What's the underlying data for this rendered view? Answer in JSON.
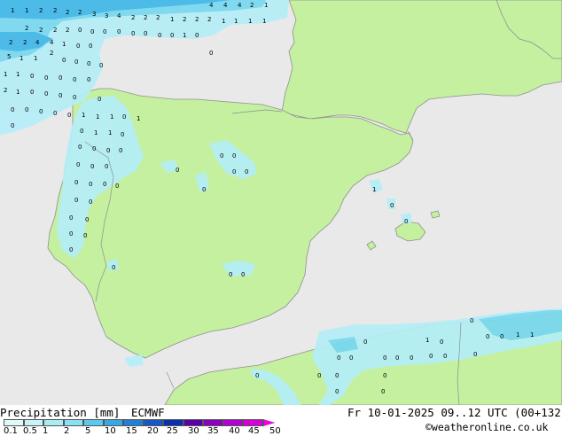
{
  "title": "Precipitation [mm]",
  "model": "ECMWF",
  "valid_time": "Fr 10-01-2025 09..12 UTC (00+132)",
  "credit": "©weatheronline.co.uk",
  "colors": {
    "sea": "#e9e9e9",
    "land": "#c4f0a0",
    "precip_light": "#b4eef8",
    "precip_medium": "#78d8f0",
    "precip_heavy": "#40b8e8",
    "border": "#909090"
  },
  "legend": {
    "labels": [
      "0.1",
      "0.5",
      "1",
      "2",
      "5",
      "10",
      "15",
      "20",
      "25",
      "30",
      "35",
      "40",
      "45",
      "50"
    ],
    "colors": [
      "#e0f8f8",
      "#c8f4f8",
      "#a8ecf6",
      "#88e0f2",
      "#5cc8ee",
      "#38a8e4",
      "#2080d8",
      "#1458c8",
      "#0a30b0",
      "#5a00a8",
      "#8c00c0",
      "#b400d0",
      "#d800d8",
      "#f000e0"
    ]
  },
  "map_values": [
    {
      "v": "1",
      "g": [
        12,
        8
      ]
    },
    {
      "v": "1",
      "g": [
        28,
        8
      ]
    },
    {
      "v": "2",
      "g": [
        44,
        8
      ]
    },
    {
      "v": "2",
      "g": [
        60,
        8
      ]
    },
    {
      "v": "2",
      "g": [
        74,
        10
      ]
    },
    {
      "v": "2",
      "g": [
        88,
        10
      ]
    },
    {
      "v": "3",
      "g": [
        104,
        12
      ]
    },
    {
      "v": "3",
      "g": [
        118,
        14
      ]
    },
    {
      "v": "4",
      "g": [
        132,
        14
      ]
    },
    {
      "v": "2",
      "g": [
        148,
        16
      ]
    },
    {
      "v": "2",
      "g": [
        162,
        16
      ]
    },
    {
      "v": "2",
      "g": [
        176,
        16
      ]
    },
    {
      "v": "1",
      "g": [
        192,
        18
      ]
    },
    {
      "v": "2",
      "g": [
        206,
        18
      ]
    },
    {
      "v": "2",
      "g": [
        220,
        18
      ]
    },
    {
      "v": "2",
      "g": [
        234,
        18
      ]
    },
    {
      "v": "1",
      "g": [
        250,
        20
      ]
    },
    {
      "v": "1",
      "g": [
        264,
        20
      ]
    },
    {
      "v": "1",
      "g": [
        280,
        20
      ]
    },
    {
      "v": "1",
      "g": [
        296,
        20
      ]
    },
    {
      "v": "4",
      "g": [
        236,
        2
      ]
    },
    {
      "v": "4",
      "g": [
        252,
        2
      ]
    },
    {
      "v": "4",
      "g": [
        268,
        2
      ]
    },
    {
      "v": "2",
      "g": [
        282,
        2
      ]
    },
    {
      "v": "1",
      "g": [
        298,
        2
      ]
    },
    {
      "v": "2",
      "g": [
        28,
        28
      ]
    },
    {
      "v": "2",
      "g": [
        44,
        30
      ]
    },
    {
      "v": "2",
      "g": [
        60,
        30
      ]
    },
    {
      "v": "2",
      "g": [
        74,
        30
      ]
    },
    {
      "v": "0",
      "g": [
        88,
        30
      ]
    },
    {
      "v": "0",
      "g": [
        102,
        32
      ]
    },
    {
      "v": "0",
      "g": [
        116,
        32
      ]
    },
    {
      "v": "0",
      "g": [
        132,
        32
      ]
    },
    {
      "v": "0",
      "g": [
        148,
        34
      ]
    },
    {
      "v": "0",
      "g": [
        162,
        34
      ]
    },
    {
      "v": "0",
      "g": [
        178,
        36
      ]
    },
    {
      "v": "0",
      "g": [
        192,
        36
      ]
    },
    {
      "v": "1",
      "g": [
        206,
        36
      ]
    },
    {
      "v": "0",
      "g": [
        220,
        36
      ]
    },
    {
      "v": "0",
      "g": [
        236,
        56
      ]
    },
    {
      "v": "2",
      "g": [
        10,
        44
      ]
    },
    {
      "v": "2",
      "g": [
        26,
        44
      ]
    },
    {
      "v": "4",
      "g": [
        40,
        44
      ]
    },
    {
      "v": "4",
      "g": [
        56,
        44
      ]
    },
    {
      "v": "1",
      "g": [
        70,
        46
      ]
    },
    {
      "v": "0",
      "g": [
        86,
        48
      ]
    },
    {
      "v": "0",
      "g": [
        100,
        48
      ]
    },
    {
      "v": "2",
      "g": [
        56,
        56
      ]
    },
    {
      "v": "5",
      "g": [
        8,
        60
      ]
    },
    {
      "v": "1",
      "g": [
        22,
        62
      ]
    },
    {
      "v": "1",
      "g": [
        38,
        62
      ]
    },
    {
      "v": "0",
      "g": [
        70,
        64
      ]
    },
    {
      "v": "0",
      "g": [
        84,
        66
      ]
    },
    {
      "v": "0",
      "g": [
        98,
        68
      ]
    },
    {
      "v": "0",
      "g": [
        112,
        70
      ]
    },
    {
      "v": "1",
      "g": [
        4,
        80
      ]
    },
    {
      "v": "1",
      "g": [
        18,
        80
      ]
    },
    {
      "v": "0",
      "g": [
        34,
        82
      ]
    },
    {
      "v": "0",
      "g": [
        50,
        84
      ]
    },
    {
      "v": "0",
      "g": [
        66,
        84
      ]
    },
    {
      "v": "0",
      "g": [
        82,
        86
      ]
    },
    {
      "v": "0",
      "g": [
        98,
        86
      ]
    },
    {
      "v": "2",
      "g": [
        4,
        98
      ]
    },
    {
      "v": "1",
      "g": [
        18,
        100
      ]
    },
    {
      "v": "0",
      "g": [
        34,
        100
      ]
    },
    {
      "v": "0",
      "g": [
        50,
        102
      ]
    },
    {
      "v": "0",
      "g": [
        66,
        104
      ]
    },
    {
      "v": "0",
      "g": [
        82,
        106
      ]
    },
    {
      "v": "0",
      "g": [
        110,
        108
      ]
    },
    {
      "v": "0",
      "g": [
        12,
        120
      ]
    },
    {
      "v": "0",
      "g": [
        28,
        120
      ]
    },
    {
      "v": "0",
      "g": [
        44,
        122
      ]
    },
    {
      "v": "0",
      "g": [
        60,
        124
      ]
    },
    {
      "v": "0",
      "g": [
        76,
        126
      ]
    },
    {
      "v": "1",
      "g": [
        92,
        126
      ]
    },
    {
      "v": "1",
      "g": [
        108,
        128
      ]
    },
    {
      "v": "1",
      "g": [
        124,
        128
      ]
    },
    {
      "v": "0",
      "g": [
        138,
        128
      ]
    },
    {
      "v": "1",
      "g": [
        154,
        130
      ]
    },
    {
      "v": "0",
      "g": [
        12,
        138
      ]
    },
    {
      "v": "0",
      "g": [
        90,
        144
      ]
    },
    {
      "v": "1",
      "g": [
        106,
        146
      ]
    },
    {
      "v": "1",
      "g": [
        122,
        146
      ]
    },
    {
      "v": "0",
      "g": [
        136,
        148
      ]
    },
    {
      "v": "0",
      "g": [
        88,
        162
      ]
    },
    {
      "v": "0",
      "g": [
        104,
        164
      ]
    },
    {
      "v": "0",
      "g": [
        120,
        166
      ]
    },
    {
      "v": "0",
      "g": [
        134,
        166
      ]
    },
    {
      "v": "0",
      "g": [
        86,
        182
      ]
    },
    {
      "v": "0",
      "g": [
        102,
        184
      ]
    },
    {
      "v": "0",
      "g": [
        118,
        184
      ]
    },
    {
      "v": "0",
      "g": [
        248,
        172
      ]
    },
    {
      "v": "0",
      "g": [
        262,
        172
      ]
    },
    {
      "v": "0",
      "g": [
        198,
        188
      ]
    },
    {
      "v": "0",
      "g": [
        262,
        190
      ]
    },
    {
      "v": "0",
      "g": [
        276,
        190
      ]
    },
    {
      "v": "0",
      "g": [
        84,
        202
      ]
    },
    {
      "v": "0",
      "g": [
        100,
        204
      ]
    },
    {
      "v": "0",
      "g": [
        116,
        204
      ]
    },
    {
      "v": "0",
      "g": [
        130,
        206
      ]
    },
    {
      "v": "0",
      "g": [
        228,
        210
      ]
    },
    {
      "v": "1",
      "g": [
        420,
        210
      ]
    },
    {
      "v": "0",
      "g": [
        84,
        222
      ]
    },
    {
      "v": "0",
      "g": [
        100,
        224
      ]
    },
    {
      "v": "0",
      "g": [
        440,
        228
      ]
    },
    {
      "v": "0",
      "g": [
        78,
        242
      ]
    },
    {
      "v": "0",
      "g": [
        96,
        244
      ]
    },
    {
      "v": "0",
      "g": [
        456,
        246
      ]
    },
    {
      "v": "0",
      "g": [
        78,
        260
      ]
    },
    {
      "v": "0",
      "g": [
        94,
        262
      ]
    },
    {
      "v": "0",
      "g": [
        78,
        278
      ]
    },
    {
      "v": "0",
      "g": [
        126,
        298
      ]
    },
    {
      "v": "0",
      "g": [
        258,
        306
      ]
    },
    {
      "v": "0",
      "g": [
        272,
        306
      ]
    },
    {
      "v": "0",
      "g": [
        530,
        358
      ]
    },
    {
      "v": "0",
      "g": [
        410,
        382
      ]
    },
    {
      "v": "1",
      "g": [
        480,
        380
      ]
    },
    {
      "v": "0",
      "g": [
        496,
        382
      ]
    },
    {
      "v": "0",
      "g": [
        548,
        376
      ]
    },
    {
      "v": "0",
      "g": [
        564,
        376
      ]
    },
    {
      "v": "1",
      "g": [
        582,
        374
      ]
    },
    {
      "v": "1",
      "g": [
        598,
        374
      ]
    },
    {
      "v": "0",
      "g": [
        380,
        400
      ]
    },
    {
      "v": "0",
      "g": [
        394,
        400
      ]
    },
    {
      "v": "0",
      "g": [
        432,
        400
      ]
    },
    {
      "v": "0",
      "g": [
        446,
        400
      ]
    },
    {
      "v": "0",
      "g": [
        462,
        400
      ]
    },
    {
      "v": "0",
      "g": [
        484,
        398
      ]
    },
    {
      "v": "0",
      "g": [
        500,
        398
      ]
    },
    {
      "v": "0",
      "g": [
        534,
        396
      ]
    },
    {
      "v": "0",
      "g": [
        288,
        420
      ]
    },
    {
      "v": "0",
      "g": [
        358,
        420
      ]
    },
    {
      "v": "0",
      "g": [
        378,
        420
      ]
    },
    {
      "v": "0",
      "g": [
        432,
        420
      ]
    },
    {
      "v": "0",
      "g": [
        378,
        438
      ]
    },
    {
      "v": "0",
      "g": [
        430,
        438
      ]
    }
  ]
}
